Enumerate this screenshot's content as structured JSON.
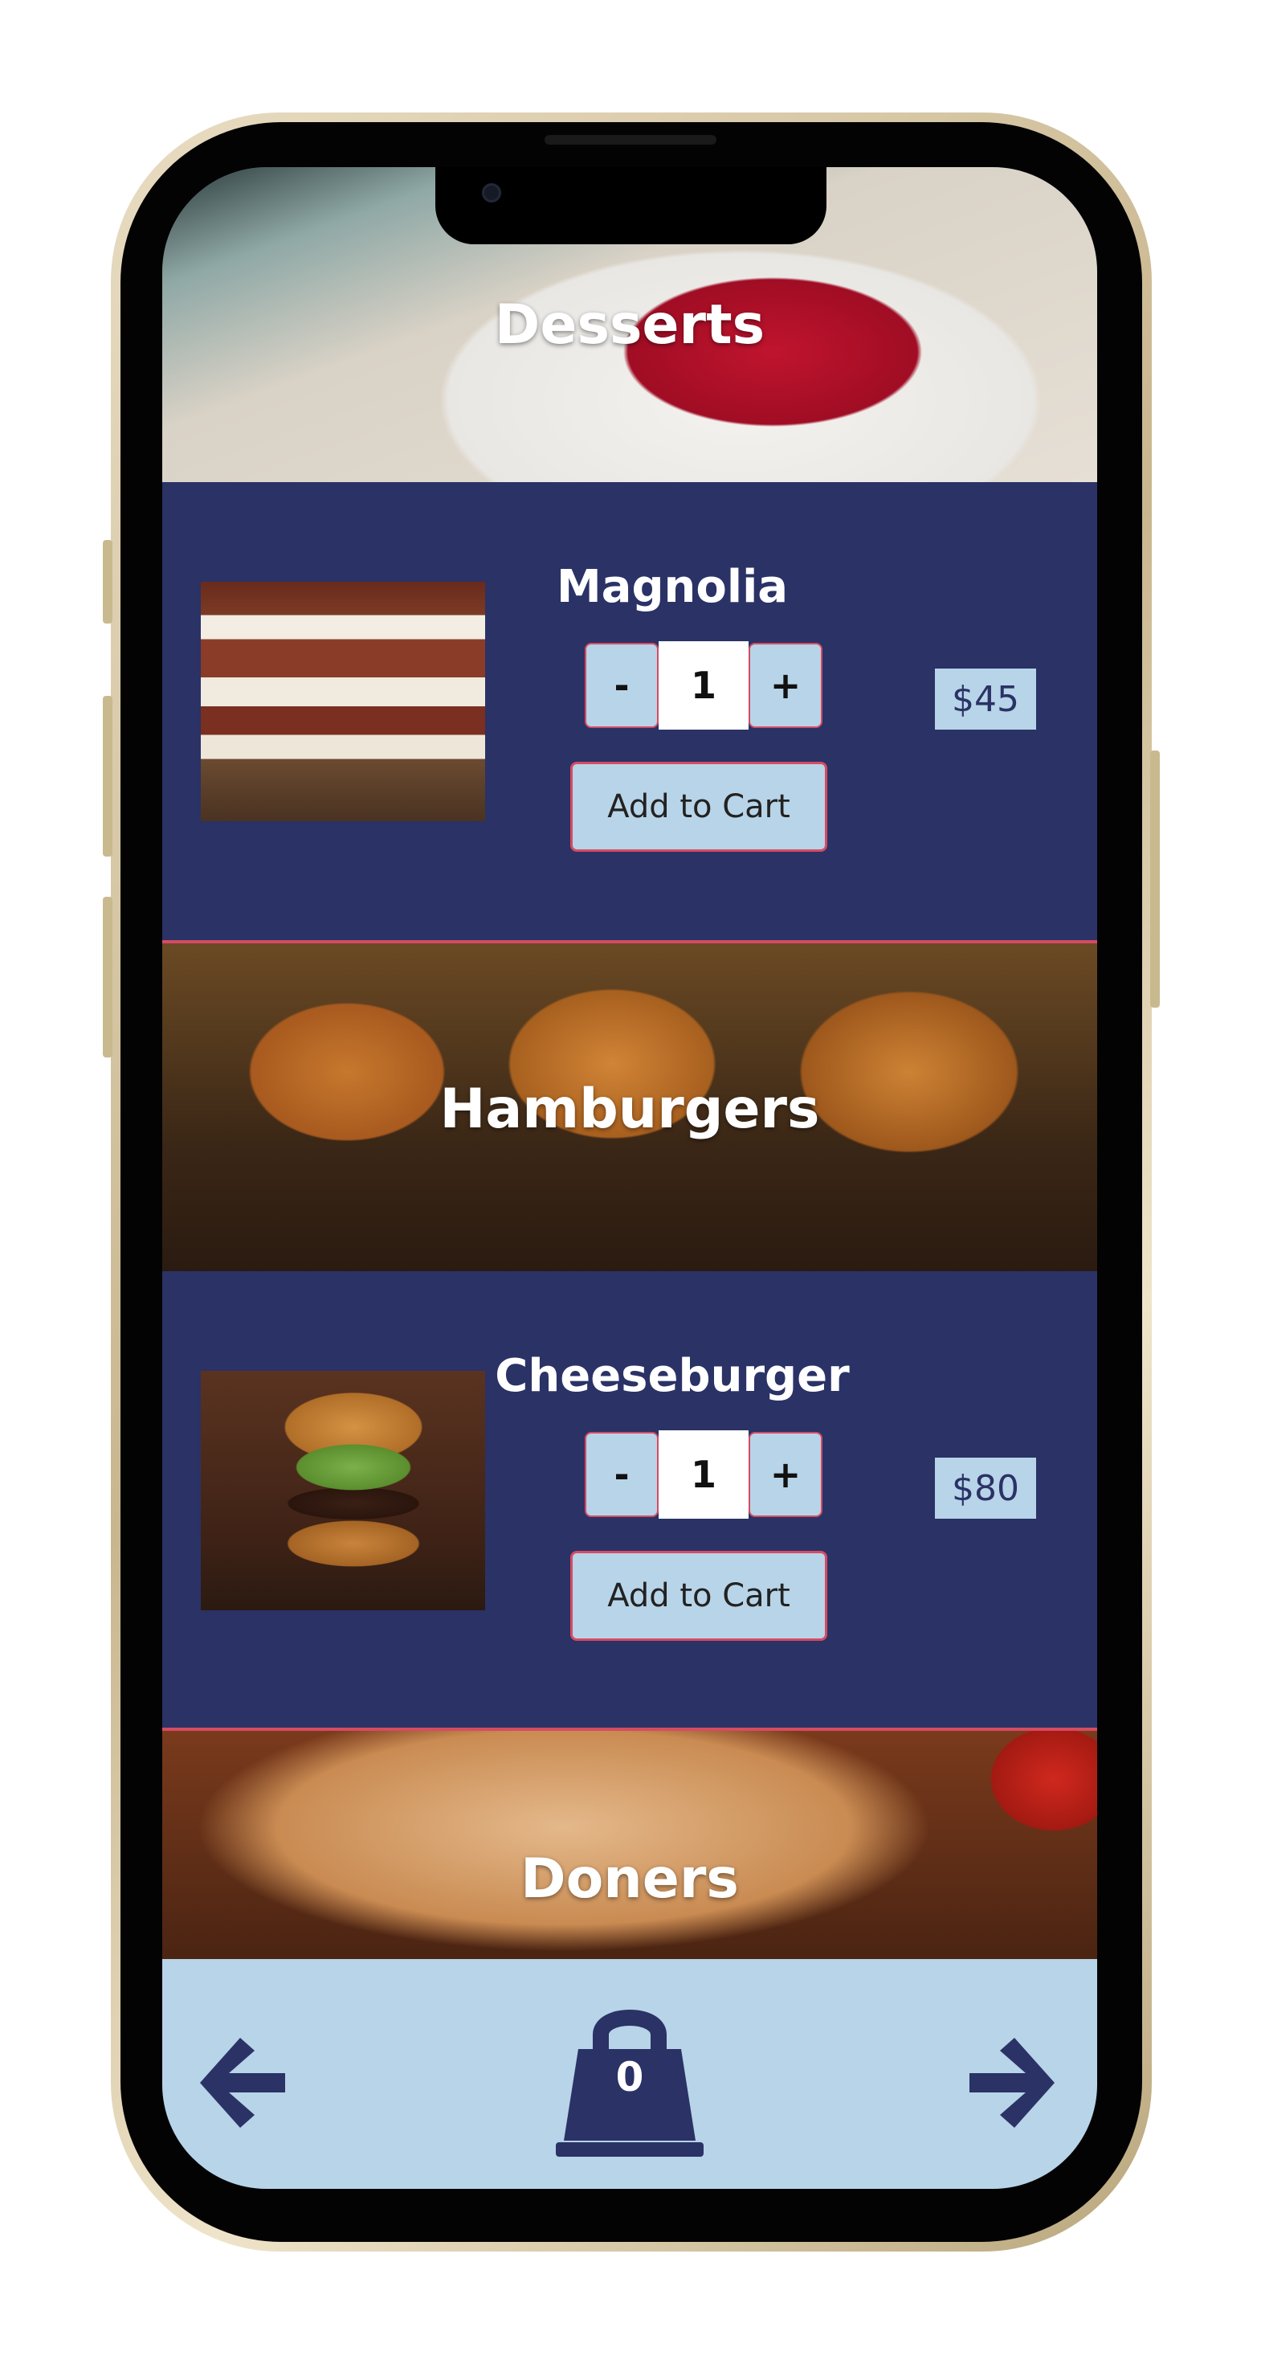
{
  "categories": [
    {
      "title": "Desserts"
    },
    {
      "title": "Hamburgers"
    },
    {
      "title": "Doners"
    }
  ],
  "products": [
    {
      "name": "Magnolia",
      "quantity": "1",
      "price": "$45",
      "add_label": "Add to Cart",
      "minus": "-",
      "plus": "+"
    },
    {
      "name": "Cheeseburger",
      "quantity": "1",
      "price": "$80",
      "add_label": "Add to Cart",
      "minus": "-",
      "plus": "+"
    }
  ],
  "nav": {
    "cart_count": "0",
    "icons": {
      "back": "arrow-left-icon",
      "cart": "shopping-bag-icon",
      "forward": "arrow-right-icon"
    }
  },
  "colors": {
    "background": "#2a3266",
    "light_blue": "#b8d4e8",
    "accent_border": "#d64b62",
    "text_light": "#ffffff"
  }
}
